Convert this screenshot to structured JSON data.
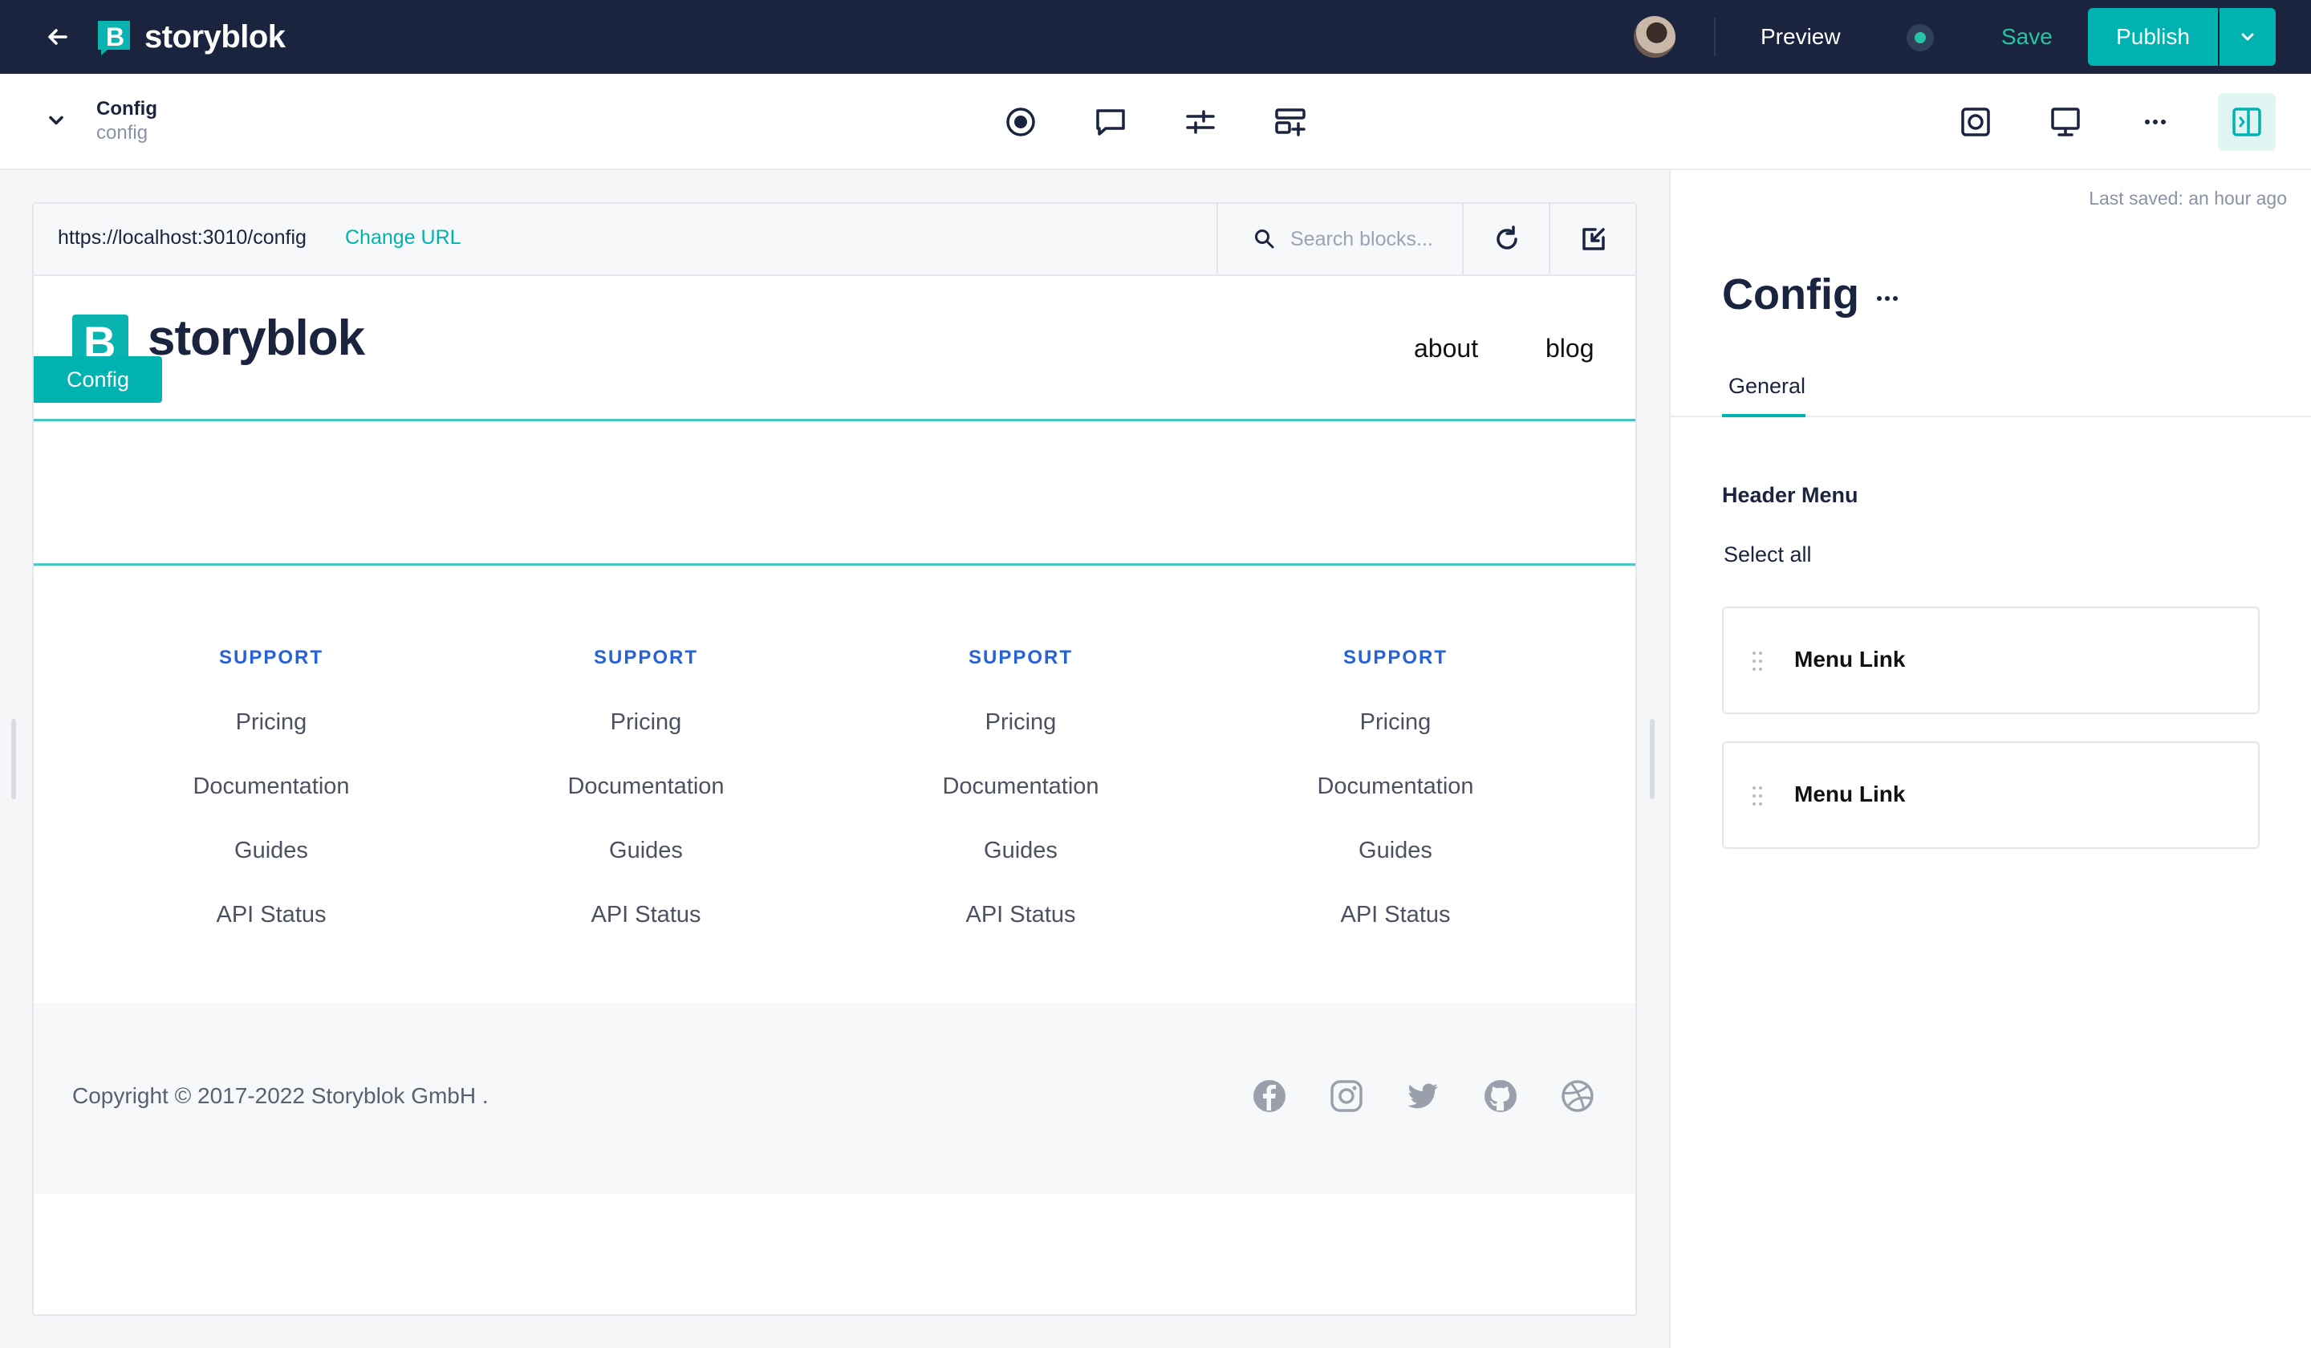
{
  "topbar": {
    "brand": "storyblok",
    "preview_label": "Preview",
    "save_label": "Save",
    "publish_label": "Publish"
  },
  "subbar": {
    "story_name": "Config",
    "story_slug": "config"
  },
  "preview": {
    "url": "https://localhost:3010/config",
    "change_url_label": "Change URL",
    "search_placeholder": "Search blocks...",
    "site_brand": "storyblok",
    "block_tag": "Config",
    "nav_links": [
      "about",
      "blog"
    ],
    "footer_columns": [
      {
        "heading": "SUPPORT",
        "links": [
          "Pricing",
          "Documentation",
          "Guides",
          "API Status"
        ]
      },
      {
        "heading": "SUPPORT",
        "links": [
          "Pricing",
          "Documentation",
          "Guides",
          "API Status"
        ]
      },
      {
        "heading": "SUPPORT",
        "links": [
          "Pricing",
          "Documentation",
          "Guides",
          "API Status"
        ]
      },
      {
        "heading": "SUPPORT",
        "links": [
          "Pricing",
          "Documentation",
          "Guides",
          "API Status"
        ]
      }
    ],
    "copyright": "Copyright © 2017-2022  Storyblok GmbH  .",
    "social_icons": [
      "facebook-icon",
      "instagram-icon",
      "twitter-icon",
      "github-icon",
      "dribbble-icon"
    ]
  },
  "panel": {
    "last_saved": "Last saved: an hour ago",
    "title": "Config",
    "tab": "General",
    "field_label": "Header Menu",
    "select_all": "Select all",
    "blocks": [
      "Menu Link",
      "Menu Link"
    ]
  },
  "colors": {
    "topbar_bg": "#1b243f",
    "accent": "#00b3b0",
    "footer_heading": "#2862d6"
  }
}
